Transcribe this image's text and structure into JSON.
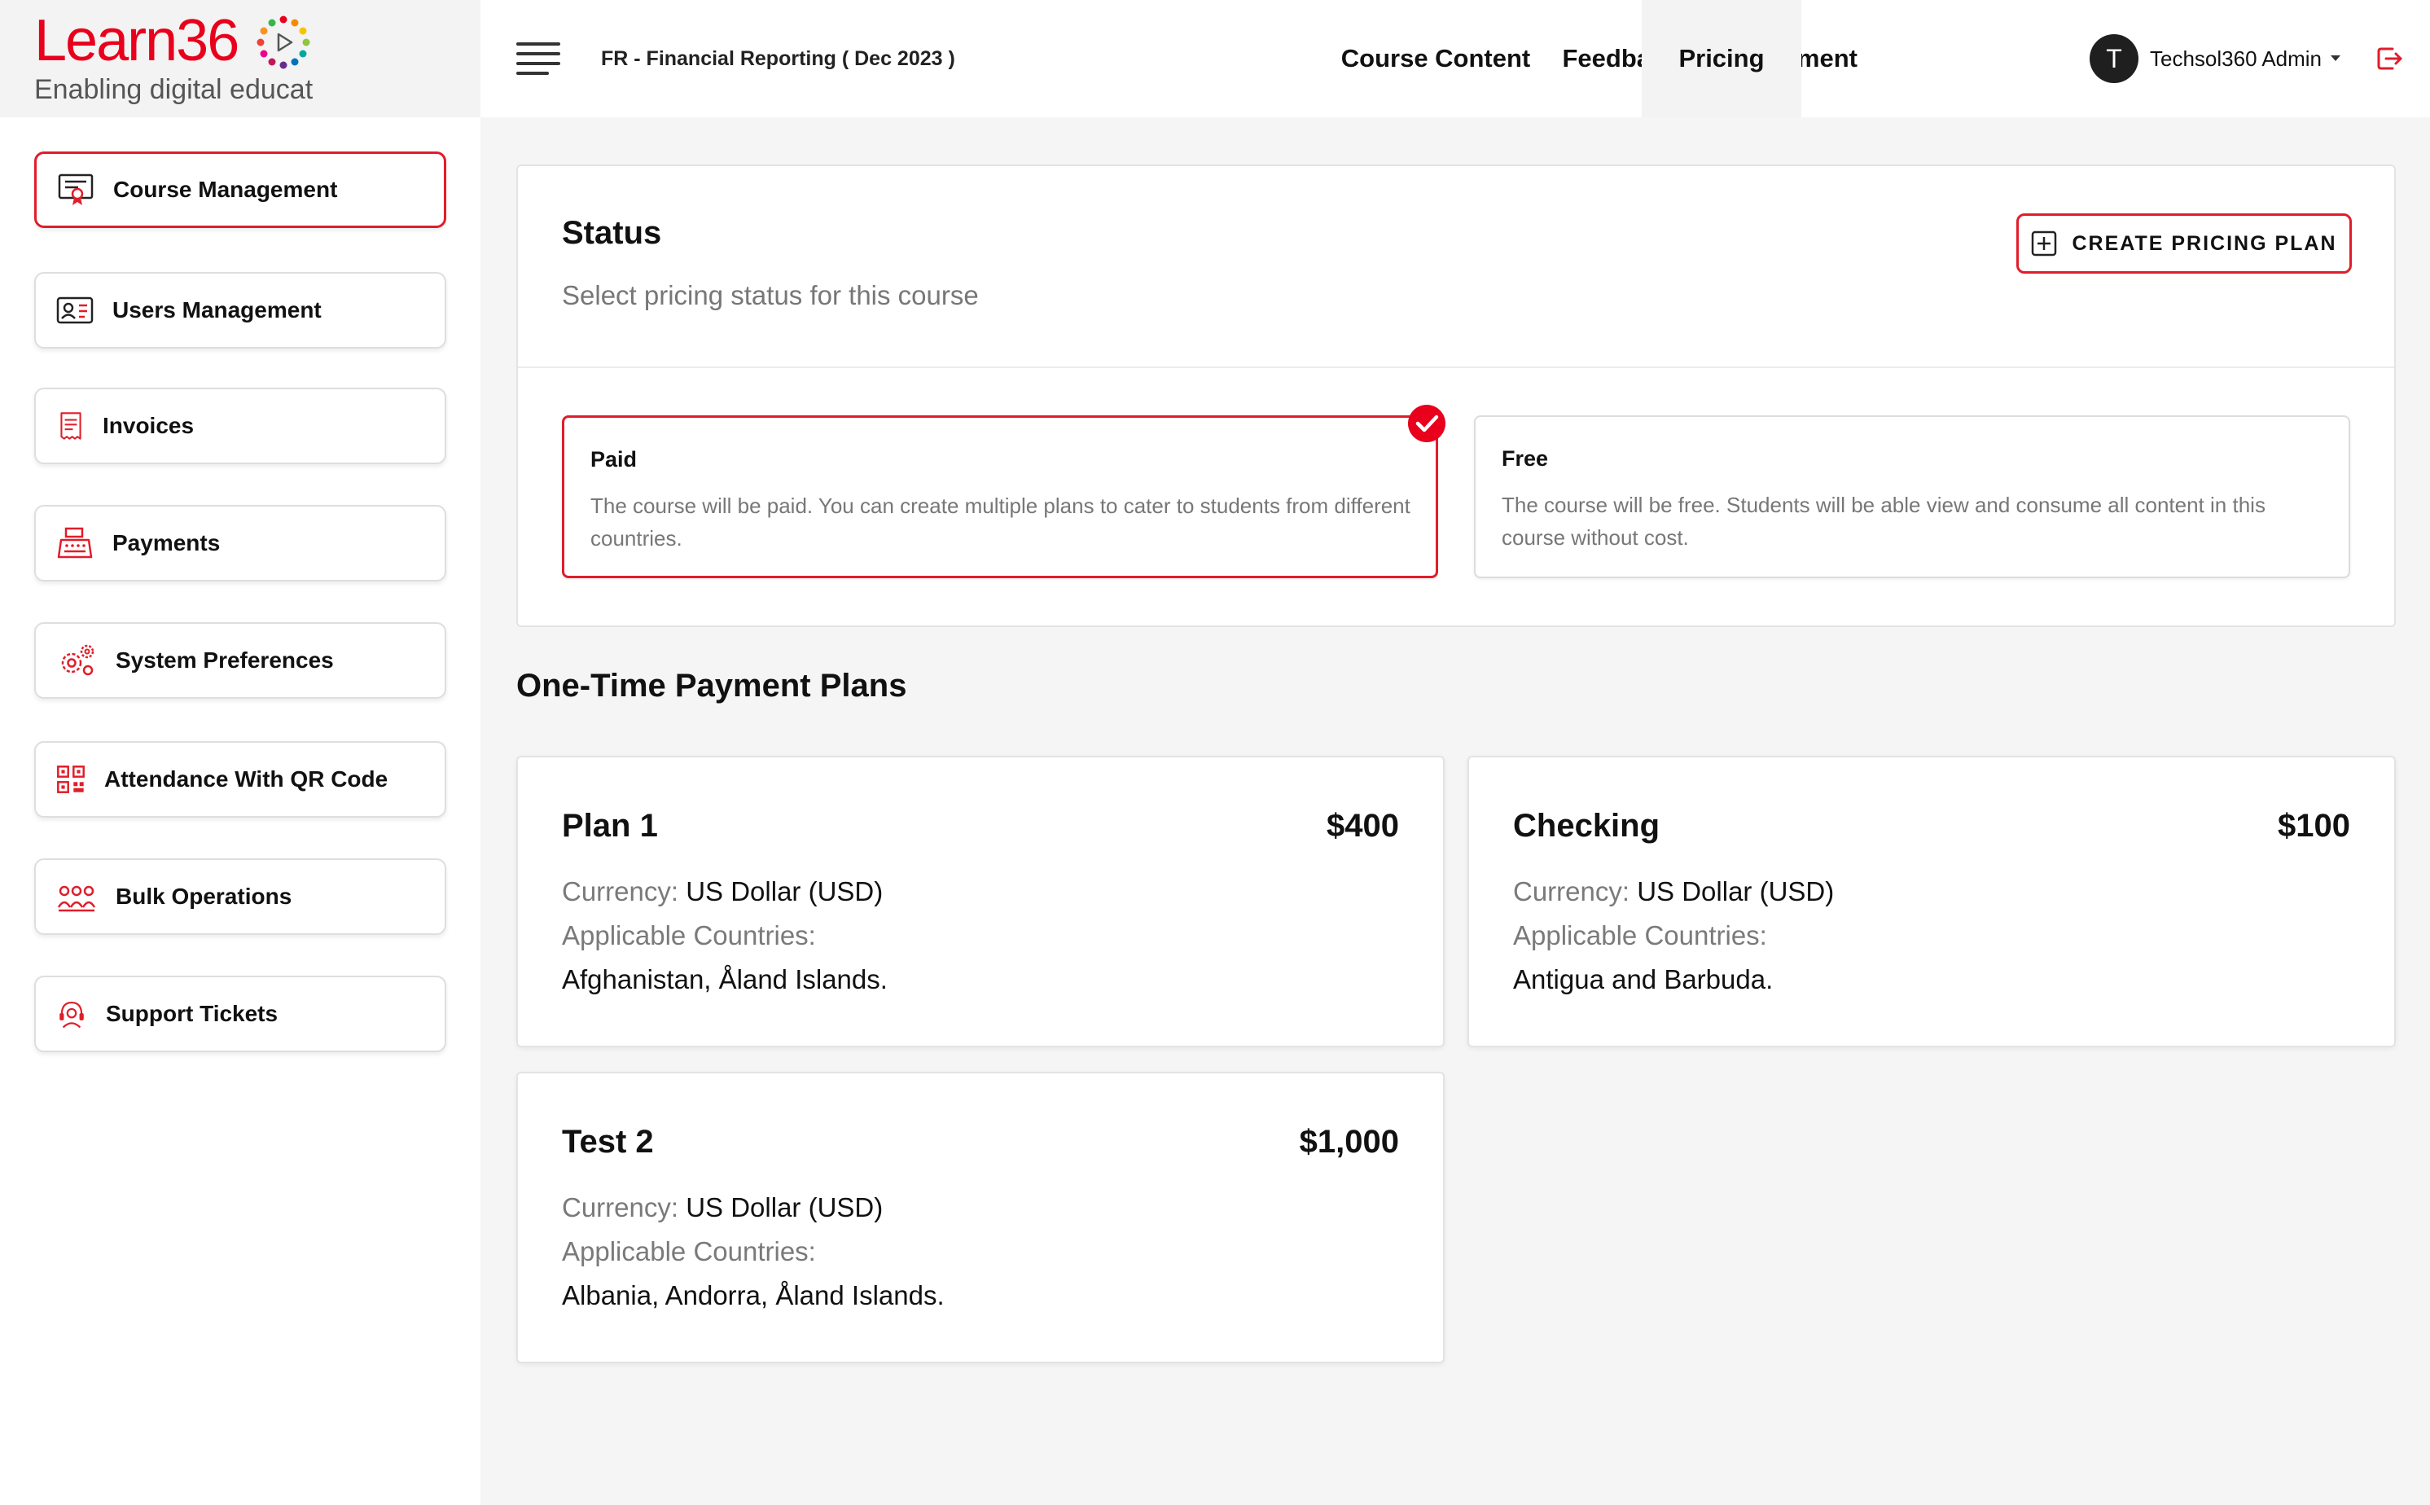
{
  "brand": {
    "logo_part1": "Learn36",
    "logo_part2": "",
    "tagline": "Enabling digital educat",
    "accent": "#e11d2a"
  },
  "sidebar": {
    "items": [
      {
        "label": "Course Management",
        "icon": "certificate-icon",
        "active": true
      },
      {
        "label": "Users Management",
        "icon": "id-card-icon",
        "active": false
      },
      {
        "label": "Invoices",
        "icon": "receipt-icon",
        "active": false
      },
      {
        "label": "Payments",
        "icon": "cash-register-icon",
        "active": false
      },
      {
        "label": "System Preferences",
        "icon": "gears-icon",
        "active": false
      },
      {
        "label": "Attendance With QR Code",
        "icon": "qr-code-icon",
        "active": false
      },
      {
        "label": "Bulk Operations",
        "icon": "users-group-icon",
        "active": false
      },
      {
        "label": "Support Tickets",
        "icon": "headset-icon",
        "active": false
      }
    ]
  },
  "header": {
    "course_title": "FR - Financial Reporting ( Dec 2023 )",
    "tabs": [
      {
        "label": "Course Content",
        "active": false
      },
      {
        "label": "Feedback",
        "active": false
      },
      {
        "label": "Enrollment",
        "active": false
      },
      {
        "label": "Pricing",
        "active": true
      }
    ],
    "user": {
      "initial": "T",
      "name": "Techsol360 Admin"
    }
  },
  "status": {
    "title": "Status",
    "subtitle": "Select pricing status for this course",
    "create_button": "CREATE PRICING PLAN",
    "options": [
      {
        "title": "Paid",
        "description": "The course will be paid. You can create multiple plans to cater to students from different countries.",
        "selected": true
      },
      {
        "title": "Free",
        "description": "The course will be free. Students will be able view and consume all content in this course without cost.",
        "selected": false
      }
    ]
  },
  "plans": {
    "heading": "One-Time Payment Plans",
    "currency_label": "Currency:",
    "countries_label": "Applicable Countries:",
    "items": [
      {
        "name": "Plan 1",
        "price": "$400",
        "currency": "US Dollar (USD)",
        "countries": "Afghanistan, Åland Islands."
      },
      {
        "name": "Checking",
        "price": "$100",
        "currency": "US Dollar (USD)",
        "countries": "Antigua and Barbuda."
      },
      {
        "name": "Test 2",
        "price": "$1,000",
        "currency": "US Dollar (USD)",
        "countries": "Albania, Andorra, Åland Islands."
      }
    ]
  }
}
